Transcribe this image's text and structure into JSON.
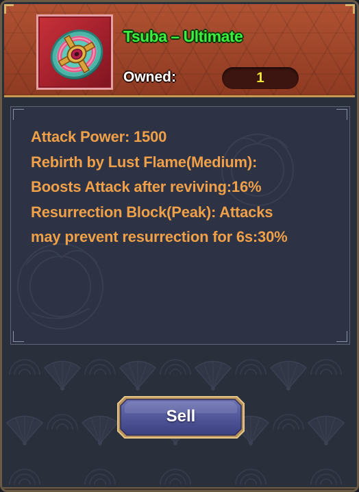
{
  "item": {
    "title": "Tsuba – Ultimate",
    "owned_label": "Owned:",
    "owned_count": "1",
    "icon": "tsuba-icon"
  },
  "description": {
    "lines": [
      "Attack Power: 1500",
      "Rebirth by Lust Flame(Medium):",
      "Boosts Attack after reviving:16%",
      "Resurrection Block(Peak): Attacks",
      "may prevent resurrection for 6s:30%"
    ]
  },
  "actions": {
    "sell_label": "Sell"
  },
  "colors": {
    "title_green": "#3bee3f",
    "description_orange": "#f0a048",
    "owned_count_yellow": "#f6e43a",
    "header_red": "#a3452a"
  }
}
